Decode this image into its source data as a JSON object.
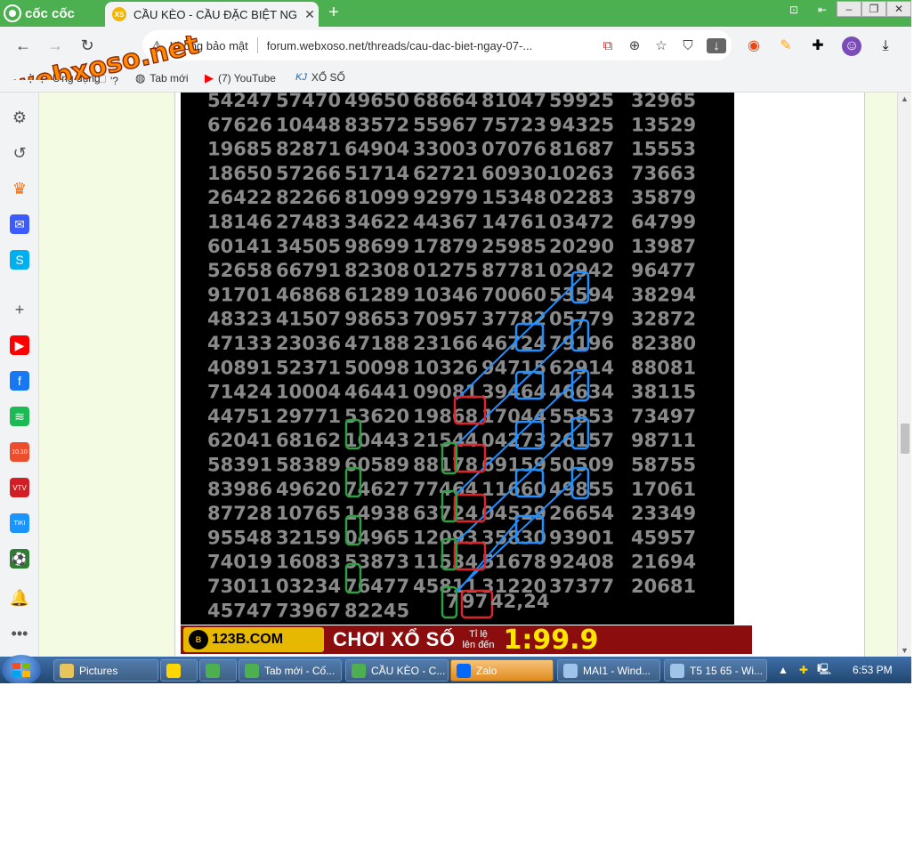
{
  "browser": {
    "brand": "cốc cốc",
    "active_tab_title": "CẦU KÈO - CẦU ĐẶC BIỆT NG",
    "active_tab_favicon": "XS",
    "new_tab_symbol": "+",
    "security_label": "Không bảo mật",
    "url": "forum.webxoso.net/threads/cau-dac-biet-ngay-07-..."
  },
  "watermark": "webxoso.net",
  "bookmarks": [
    {
      "icon": "apps-icon",
      "label": "Ứng dụng"
    },
    {
      "icon": "folder-icon",
      "label": "'?"
    },
    {
      "icon": "globe-icon",
      "label": "Tab mới"
    },
    {
      "icon": "youtube-icon",
      "label": "(7) YouTube"
    },
    {
      "icon": "kj-icon",
      "label": "XỔ SỐ",
      "badge": "KJ"
    }
  ],
  "sidebar": [
    {
      "icon": "gear-icon",
      "color": "#555555",
      "glyph": "⚙"
    },
    {
      "icon": "history-icon",
      "color": "#555555",
      "glyph": "↺"
    },
    {
      "icon": "crown-icon",
      "color": "#ff6a00",
      "glyph": "♛"
    },
    {
      "icon": "messenger-icon",
      "color": "#3b5bff",
      "glyph": "✉"
    },
    {
      "icon": "skype-icon",
      "color": "#00aff0",
      "glyph": "S"
    },
    {
      "icon": "plus-icon",
      "color": "#555555",
      "glyph": "+"
    },
    {
      "icon": "youtube-icon",
      "color": "#ff0000",
      "glyph": "▶"
    },
    {
      "icon": "facebook-icon",
      "color": "#1877f2",
      "glyph": "f"
    },
    {
      "icon": "spotify-icon",
      "color": "#1db954",
      "glyph": "≋"
    },
    {
      "icon": "shopee-icon",
      "color": "#ee4d2d",
      "glyph": "10.10"
    },
    {
      "icon": "vtv-icon",
      "color": "#d21f26",
      "glyph": "VTV"
    },
    {
      "icon": "tiki-icon",
      "color": "#1a94ff",
      "glyph": "TIKI"
    },
    {
      "icon": "football-icon",
      "color": "#2e7d32",
      "glyph": "⚽"
    },
    {
      "icon": "bell-icon",
      "color": "#555555",
      "glyph": "🔔"
    },
    {
      "icon": "more-icon",
      "color": "#555555",
      "glyph": "•••"
    }
  ],
  "lottery_rows": [
    [
      "54247",
      "57470",
      "49650",
      "68664",
      "81047",
      "59925",
      "32965"
    ],
    [
      "67626",
      "10448",
      "83572",
      "55967",
      "75723",
      "94325",
      "13529"
    ],
    [
      "19685",
      "82871",
      "64904",
      "33003",
      "07076",
      "81687",
      "15553"
    ],
    [
      "18650",
      "57266",
      "51714",
      "62721",
      "60930.",
      "10263",
      "73663"
    ],
    [
      "26422",
      "82266",
      "81099",
      "92979",
      "15348",
      "02283",
      "35879"
    ],
    [
      "18146",
      "27483",
      "34622",
      "44367",
      "14761",
      "03472",
      "64799"
    ],
    [
      "60141",
      "34505",
      "98699",
      "17879",
      "25985",
      "20290",
      "13987"
    ],
    [
      "52658",
      "66791",
      "82308",
      "01275",
      "87781",
      "02942",
      "96477"
    ],
    [
      "91701",
      "46868",
      "61289",
      "10346",
      "70060",
      "53594",
      "38294"
    ],
    [
      "48323",
      "41507",
      "98653",
      "70957",
      "37782",
      "05779",
      "32872"
    ],
    [
      "47133",
      "23036",
      "47188",
      "23166",
      "46724",
      "79196",
      "82380"
    ],
    [
      "40891",
      "52371",
      "50098",
      "10326",
      "94715",
      "62914",
      "88081"
    ],
    [
      "71424",
      "10004",
      "46441",
      "09081",
      "39464",
      "46634",
      "38115"
    ],
    [
      "44751",
      "29771",
      "53620",
      "19868",
      "17044",
      "55853",
      "73497"
    ],
    [
      "62041",
      "68162",
      "10443",
      "21544",
      "04273",
      "26157",
      "98711"
    ],
    [
      "58391",
      "58389",
      "60589",
      "88178",
      "69159",
      "50509",
      "58755"
    ],
    [
      "83986",
      "49620",
      "74627",
      "77464",
      "11660",
      "49855",
      "17061"
    ],
    [
      "87728",
      "10765",
      "14938",
      "63724",
      "04529",
      "26654",
      "23349"
    ],
    [
      "95548",
      "32159",
      "04965",
      "12093",
      "35830",
      "93901",
      "45957"
    ],
    [
      "74019",
      "16083",
      "53873",
      "11534",
      "51678",
      "92408",
      "21694"
    ],
    [
      "73011",
      "03234",
      "76477",
      "45811",
      "31220",
      "37377",
      "20681"
    ],
    [
      "45747",
      "73967",
      "82245"
    ]
  ],
  "results": {
    "green": "7",
    "red": "97",
    "pair": "42,24"
  },
  "banner": {
    "brand": "123B.COM",
    "coin": "B",
    "headline": "CHƠI XỔ SỐ",
    "ratio_line1": "Tỉ lệ",
    "ratio_line2": "lên đến",
    "ratio": "1:99.9"
  },
  "taskbar": {
    "tasks": [
      {
        "icon": "folder-icon",
        "label": "Pictures"
      },
      {
        "icon": "addon-icon",
        "label": ""
      },
      {
        "icon": "chrome-icon",
        "label": ""
      },
      {
        "icon": "coccoc-icon",
        "label": "Tab mới - Cố..."
      },
      {
        "icon": "coccoc-icon",
        "label": "CẦU KÈO - C..."
      },
      {
        "icon": "zalo-icon",
        "label": "Zalo",
        "active": true
      },
      {
        "icon": "window-icon",
        "label": "MAI1 - Wind..."
      },
      {
        "icon": "window-icon",
        "label": "T5 15 65 - Wi..."
      }
    ],
    "clock": "6:53 PM"
  },
  "colors": {
    "tab_green": "#4caf50",
    "grid_text": "#8a8a8a",
    "box_blue": "#1e90ff",
    "box_red": "#e0242a",
    "box_green": "#2ea043"
  }
}
